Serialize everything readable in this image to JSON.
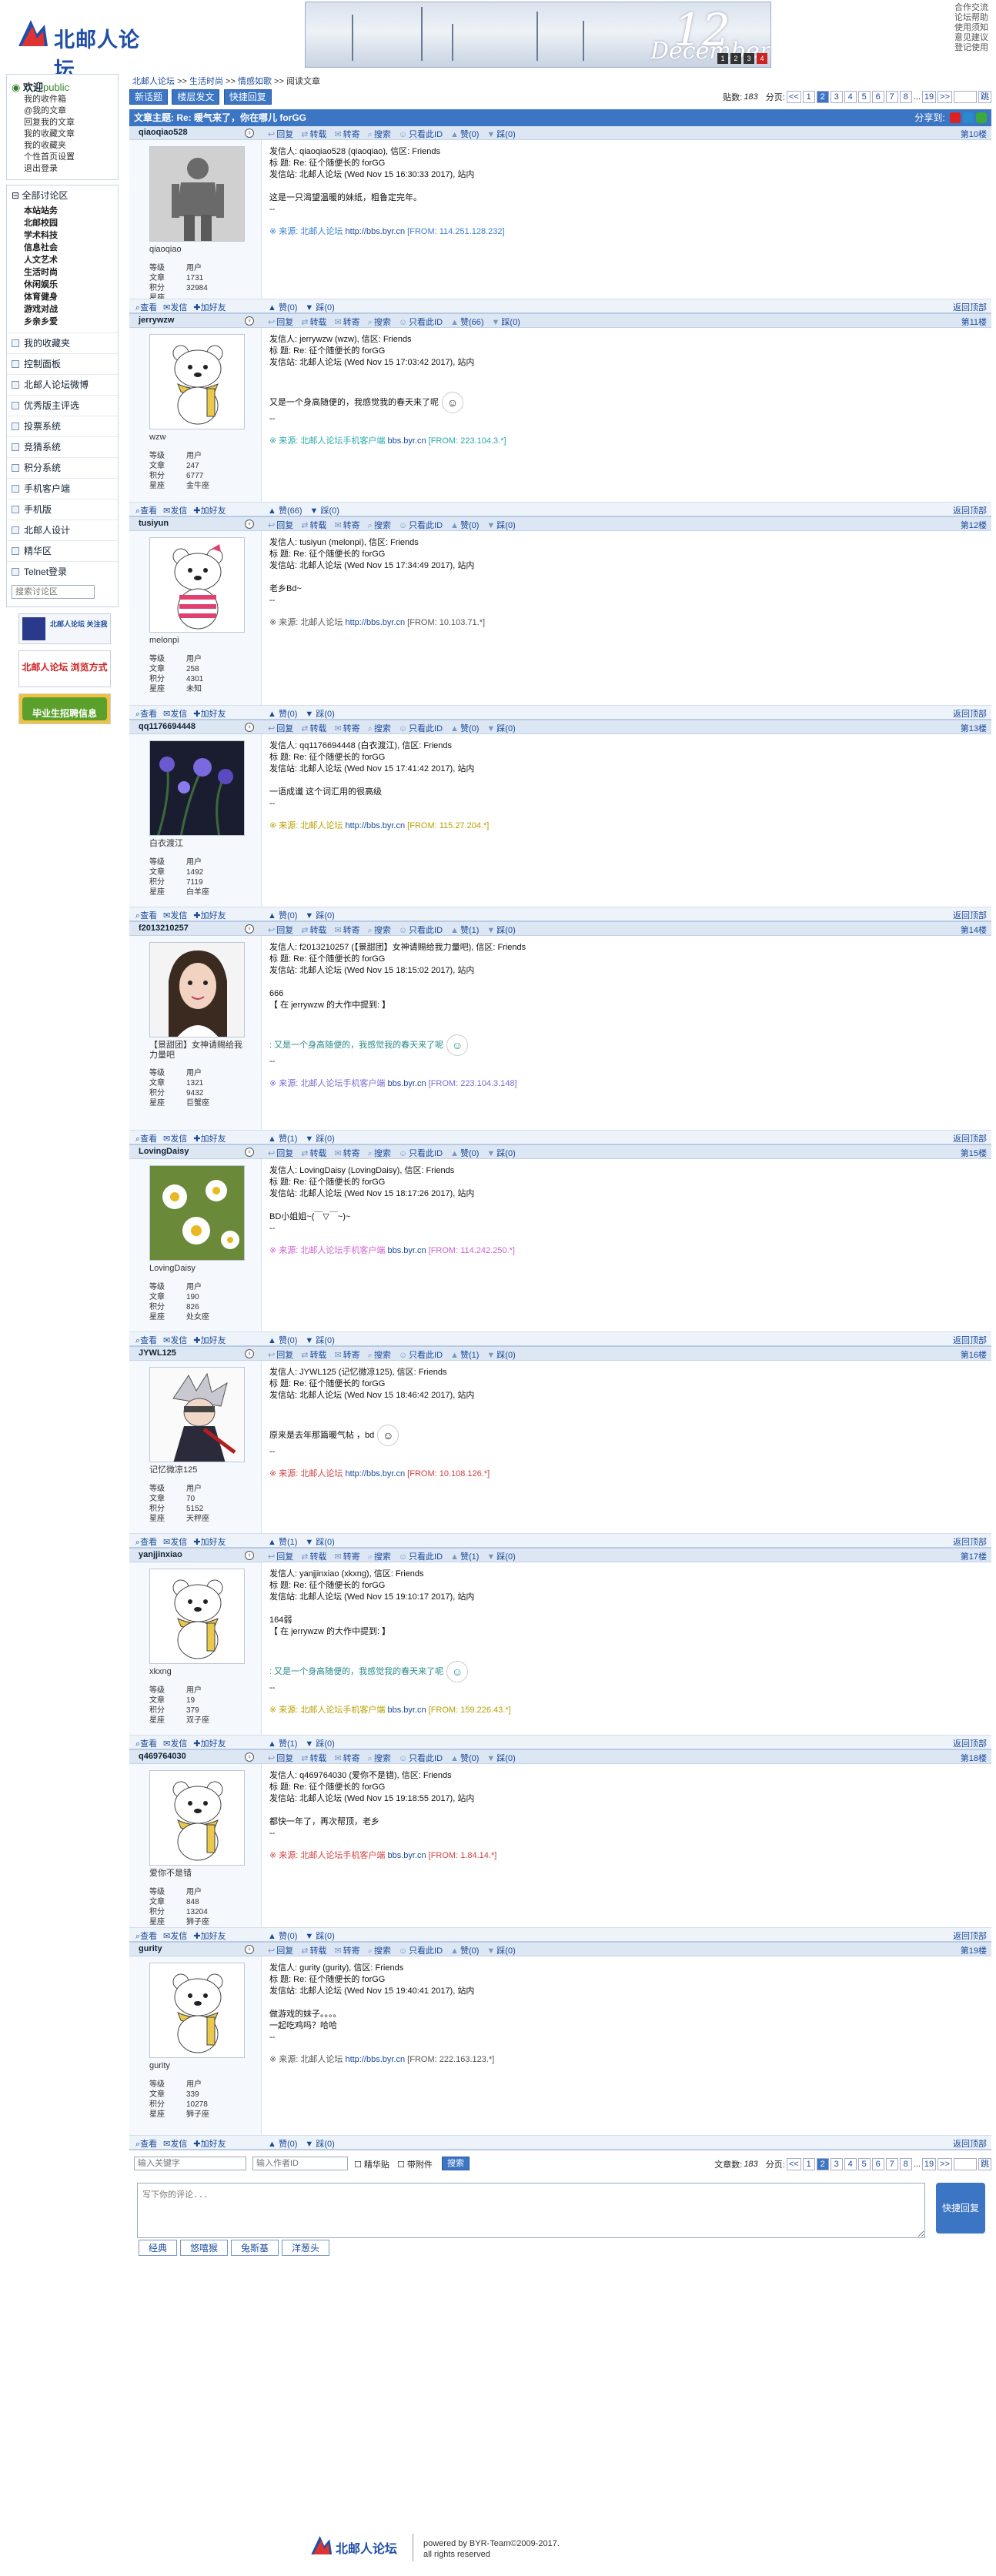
{
  "header": {
    "logo_text": "北邮人论坛",
    "banner_day": "12",
    "banner_month": "December",
    "banner_dots": [
      "1",
      "2",
      "3",
      "4"
    ],
    "top_links": [
      "合作交流",
      "论坛帮助",
      "使用须知",
      "意见建议",
      "登记使用"
    ]
  },
  "sidebar": {
    "welcome": "欢迎",
    "user": "public",
    "user_links": [
      "我的收件箱",
      "@我的文章",
      "回复我的文章",
      "我的收藏文章",
      "我的收藏夹",
      "个性首页设置",
      "退出登录"
    ],
    "all_boards": "全部讨论区",
    "board_sections": [
      "本站站务",
      "北邮校园",
      "学术科技",
      "信息社会",
      "人文艺术",
      "生活时尚",
      "休闲娱乐",
      "体育健身",
      "游戏对战",
      "乡亲乡爱"
    ],
    "menu_items": [
      "我的收藏夹",
      "控制面板",
      "北邮人论坛微博",
      "优秀版主评选",
      "投票系统",
      "竞猜系统",
      "积分系统",
      "手机客户端",
      "手机版",
      "北邮人设计",
      "精华区",
      "Telnet登录"
    ],
    "search_placeholder": "搜索讨论区",
    "ads": [
      "北邮人论坛 关注我",
      "北邮人论坛 浏览方式",
      "毕业生招聘信息"
    ]
  },
  "main": {
    "crumb": [
      "北邮人论坛",
      ">>",
      "生活时尚",
      ">>",
      "情感如歌",
      ">>",
      "阅读文章"
    ],
    "buttons": [
      "新话题",
      "楼层发文",
      "快捷回复"
    ],
    "post_count_label": "贴数:",
    "post_count": "183",
    "page_label": "分页:",
    "pages": [
      "<<",
      "1",
      "2",
      "3",
      "4",
      "5",
      "6",
      "7",
      "8",
      "...",
      "19",
      ">>"
    ],
    "go_label": "跳",
    "topic_title": "文章主题: Re: 暖气来了，你在哪儿 forGG",
    "share_label": "分享到:"
  },
  "actions_top": [
    "回复",
    "转载",
    "转寄",
    "搜索",
    "只看此ID",
    "赞",
    "踩"
  ],
  "actions_bottom": [
    "查看",
    "发信",
    "加好友"
  ],
  "back_top": "返回顶部",
  "labels": {
    "level": "等级",
    "posts": "文章",
    "score": "积分",
    "star": "星座",
    "user_level": "用户"
  },
  "posts": [
    {
      "floor": "第10楼",
      "author": "qiaoqiao528",
      "nick": "qiaoqiao",
      "stats": [
        "用户",
        "1731",
        "32984"
      ],
      "star": "",
      "lines": [
        "发信人: qiaoqiao528 (qiaoqiao), 信区: Friends",
        "标  题: Re: 征个随便长的 forGG",
        "发信站: 北邮人论坛 (Wed Nov 15 16:30:33 2017), 站内",
        "",
        "这是一只渴望温暖的妹纸，粗鲁定完年。",
        "--"
      ],
      "src_prefix": "※ 来源: 北邮人论坛",
      "src_link": "http://bbs.byr.cn",
      "src_ip": "[FROM: 114.251.128.232]",
      "src_color": "#3a7dd0",
      "zan": "(0)",
      "cai": "(0)",
      "avatar": "mannequin"
    },
    {
      "floor": "第11楼",
      "author": "jerrywzw",
      "nick": "wzw",
      "stats": [
        "用户",
        "247",
        "6777"
      ],
      "star": "金牛座",
      "lines": [
        "发信人: jerrywzw (wzw), 信区: Friends",
        "标  题: Re: 征个随便长的 forGG",
        "发信站: 北邮人论坛 (Wed Nov 15 17:03:42 2017), 站内",
        "",
        "",
        "又是一个身高随便的，我感觉我的春天来了呢",
        "--"
      ],
      "src_prefix": "※ 来源: 北邮人论坛手机客户端",
      "src_link": "bbs.byr.cn",
      "src_ip": "[FROM: 223.104.3.*]",
      "src_color": "#2aa8a8",
      "zan": "(66)",
      "cai": "(0)",
      "avatar": "bear"
    },
    {
      "floor": "第12楼",
      "author": "tusiyun",
      "nick": "melonpi",
      "stats": [
        "用户",
        "258",
        "4301"
      ],
      "star": "未知",
      "lines": [
        "发信人: tusiyun (melonpi), 信区: Friends",
        "标  题: Re: 征个随便长的 forGG",
        "发信站: 北邮人论坛 (Wed Nov 15 17:34:49 2017), 站内",
        "",
        "老乡Bd~",
        "--"
      ],
      "src_prefix": "※ 来源: 北邮人论坛",
      "src_link": "http://bbs.byr.cn",
      "src_ip": "[FROM: 10.103.71.*]",
      "src_color": "#555",
      "zan": "(0)",
      "cai": "(0)",
      "avatar": "bear-pink"
    },
    {
      "floor": "第13楼",
      "author": "qq1176694448",
      "nick": "白衣渡江",
      "stats": [
        "用户",
        "1492",
        "7119"
      ],
      "star": "白羊座",
      "lines": [
        "发信人: qq1176694448 (白衣渡江), 信区: Friends",
        "标  题: Re: 征个随便长的 forGG",
        "发信站: 北邮人论坛 (Wed Nov 15 17:41:42 2017), 站内",
        "",
        "一语成谶 这个词汇用的很高级",
        "--"
      ],
      "src_prefix": "※ 来源: 北邮人论坛",
      "src_link": "http://bbs.byr.cn",
      "src_ip": "[FROM: 115.27.204.*]",
      "src_color": "#b8a000",
      "zan": "(0)",
      "cai": "(0)",
      "avatar": "flowers"
    },
    {
      "floor": "第14楼",
      "author": "f2013210257",
      "nick": "【景甜团】女神请赐给我力量吧",
      "stats": [
        "用户",
        "1321",
        "9432"
      ],
      "star": "巨蟹座",
      "lines": [
        "发信人: f2013210257 (【景甜团】女神请赐给我力量吧), 信区: Friends",
        "标  题: Re: 征个随便长的 forGG",
        "发信站: 北邮人论坛 (Wed Nov 15 18:15:02 2017), 站内",
        "",
        "666",
        "【 在 jerrywzw 的大作中提到: 】",
        "",
        "",
        ": 又是一个身高随便的，我感觉我的春天来了呢",
        "--"
      ],
      "quote_index": 8,
      "src_prefix": "※ 来源: 北邮人论坛手机客户端",
      "src_link": "bbs.byr.cn",
      "src_ip": "[FROM: 223.104.3.148]",
      "src_color": "#7a6acc",
      "zan": "(1)",
      "cai": "(0)",
      "avatar": "girl"
    },
    {
      "floor": "第15楼",
      "author": "LovingDaisy",
      "nick": "LovingDaisy",
      "stats": [
        "用户",
        "190",
        "826"
      ],
      "star": "处女座",
      "lines": [
        "发信人: LovingDaisy (LovingDaisy), 信区: Friends",
        "标  题: Re: 征个随便长的 forGG",
        "发信站: 北邮人论坛 (Wed Nov 15 18:17:26 2017), 站内",
        "",
        "BD小姐姐~(￣▽￣~)~",
        "--"
      ],
      "src_prefix": "※ 来源: 北邮人论坛手机客户端",
      "src_link": "bbs.byr.cn",
      "src_ip": "[FROM: 114.242.250.*]",
      "src_color": "#d060d0",
      "zan": "(0)",
      "cai": "(0)",
      "avatar": "daisy"
    },
    {
      "floor": "第16楼",
      "author": "JYWL125",
      "nick": "记忆微凉125",
      "stats": [
        "用户",
        "70",
        "5152"
      ],
      "star": "天秤座",
      "lines": [
        "发信人: JYWL125 (记忆微凉125), 信区: Friends",
        "标  题: Re: 征个随便长的 forGG",
        "发信站: 北邮人论坛 (Wed Nov 15 18:46:42 2017), 站内",
        "",
        "",
        "原来是去年那篇暖气帖       ，bd",
        "--"
      ],
      "src_prefix": "※ 来源: 北邮人论坛",
      "src_link": "http://bbs.byr.cn",
      "src_ip": "[FROM: 10.108.126.*]",
      "src_color": "#d04040",
      "zan": "(1)",
      "cai": "(0)",
      "avatar": "ninja"
    },
    {
      "floor": "第17楼",
      "author": "yanjjinxiao",
      "nick": "xkxng",
      "stats": [
        "用户",
        "19",
        "379"
      ],
      "star": "双子座",
      "lines": [
        "发信人: yanjjinxiao (xkxng), 信区: Friends",
        "标  题: Re: 征个随便长的 forGG",
        "发信站: 北邮人论坛 (Wed Nov 15 19:10:17 2017), 站内",
        "",
        "164弱",
        "【 在 jerrywzw 的大作中提到: 】",
        "",
        "",
        ": 又是一个身高随便的，我感觉我的春天来了呢",
        "--"
      ],
      "quote_index": 8,
      "src_prefix": "※ 来源: 北邮人论坛手机客户端",
      "src_link": "bbs.byr.cn",
      "src_ip": "[FROM: 159.226.43.*]",
      "src_color": "#b8a000",
      "zan": "(1)",
      "cai": "(0)",
      "avatar": "bear"
    },
    {
      "floor": "第18楼",
      "author": "q469764030",
      "nick": "爱你不是错",
      "stats": [
        "用户",
        "848",
        "13204"
      ],
      "star": "狮子座",
      "lines": [
        "发信人: q469764030 (爱你不是错), 信区: Friends",
        "标  题: Re: 征个随便长的 forGG",
        "发信站: 北邮人论坛 (Wed Nov 15 19:18:55 2017), 站内",
        "",
        "都快一年了，再次帮顶，老乡",
        "--"
      ],
      "src_prefix": "※ 来源: 北邮人论坛手机客户端",
      "src_link": "bbs.byr.cn",
      "src_ip": "[FROM: 1.84.14.*]",
      "src_color": "#d04040",
      "zan": "(0)",
      "cai": "(0)",
      "avatar": "bear"
    },
    {
      "floor": "第19楼",
      "author": "gurity",
      "nick": "gurity",
      "stats": [
        "用户",
        "339",
        "10278"
      ],
      "star": "狮子座",
      "lines": [
        "发信人: gurity (gurity), 信区: Friends",
        "标  题: Re: 征个随便长的 forGG",
        "发信站: 北邮人论坛 (Wed Nov 15 19:40:41 2017), 站内",
        "",
        "做游戏的妹子。。。。",
        "一起吃鸡吗？哈哈",
        "--"
      ],
      "src_prefix": "※ 来源: 北邮人论坛",
      "src_link": "http://bbs.byr.cn",
      "src_ip": "[FROM: 222.163.123.*]",
      "src_color": "#555",
      "zan": "(0)",
      "cai": "(0)",
      "avatar": "bear"
    }
  ],
  "bottom": {
    "keyword_placeholder": "输入关键字",
    "author_placeholder": "输入作者ID",
    "chk_topic": "精华贴",
    "chk_attach": "带附件",
    "search_btn": "搜索",
    "article_count_label": "文章数:",
    "article_count": "183",
    "page_label": "分页:",
    "reply_placeholder": "写下你的评论...",
    "quick_reply": "快捷回复",
    "emo_tabs": [
      "经典",
      "悠嘻猴",
      "兔斯基",
      "洋葱头"
    ]
  },
  "footer": {
    "logo_text": "北邮人论坛",
    "powered": "powered by BYR-Team©2009-2017.",
    "rights": "all rights reserved"
  },
  "colors": {
    "accent": "#3c75c4",
    "bar": "#dde7f4"
  }
}
